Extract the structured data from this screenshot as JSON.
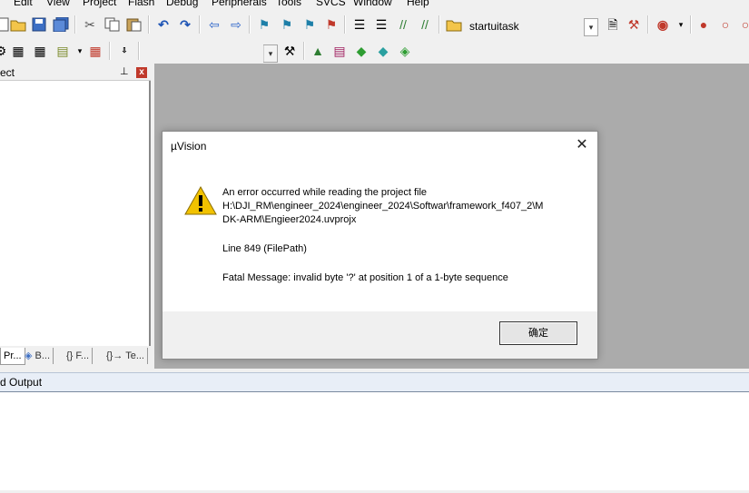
{
  "menu": [
    "Edit",
    "View",
    "Project",
    "Flash",
    "Debug",
    "Peripherals",
    "Tools",
    "SVCS",
    "Window",
    "Help"
  ],
  "toolbar": {
    "target_combo_value": "startuitask",
    "icons": [
      "new-file-icon",
      "open-folder-icon",
      "save-icon",
      "save-all-icon",
      "cut-icon",
      "copy-icon",
      "paste-icon",
      "undo-icon",
      "redo-icon",
      "back-icon",
      "forward-icon",
      "bookmark-icon",
      "prev-bookmark-icon",
      "next-bookmark-icon",
      "clear-bookmarks-icon",
      "indent-icon",
      "unindent-icon",
      "comment-icon",
      "uncomment-icon",
      "find-in-files-icon",
      "find-icon",
      "debug-icon",
      "breakpoint-icon"
    ]
  },
  "project_panel": {
    "title": "ect",
    "pin": "⊥",
    "close": "x",
    "tabs": [
      "Pr...",
      "B...",
      "{} F...",
      "{}→ Te..."
    ]
  },
  "output_panel": {
    "title": "d Output"
  },
  "dialog": {
    "title": "µVision",
    "close": "✕",
    "lines": [
      "An error occurred while reading the project file",
      "H:\\DJI_RM\\engineer_2024\\engineer_2024\\Softwar\\framework_f407_2\\M",
      "DK-ARM\\Engieer2024.uvprojx"
    ],
    "line_info": "Line 849 (FilePath)",
    "fatal": "Fatal Message: invalid byte '?' at position 1 of a 1-byte sequence",
    "ok_label": "确定"
  },
  "colors": {
    "editor_bg": "#ababab",
    "dialog_footer": "#f0f0f0",
    "warning_yellow": "#f2c200"
  }
}
